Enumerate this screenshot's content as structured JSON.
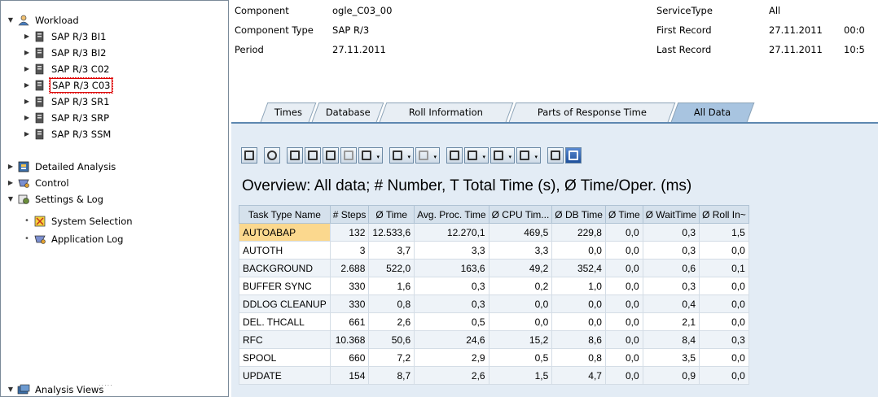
{
  "tree": {
    "workload": "Workload",
    "systems": [
      "SAP R/3 BI1",
      "SAP R/3 BI2",
      "SAP R/3 C02",
      "SAP R/3 C03",
      "SAP R/3 SR1",
      "SAP R/3 SRP",
      "SAP R/3 SSM"
    ],
    "detailed_analysis": "Detailed Analysis",
    "control": "Control",
    "settings_log": "Settings & Log",
    "system_selection": "System Selection",
    "application_log": "Application Log",
    "analysis_views": "Analysis Views",
    "grip": "....."
  },
  "header": {
    "component_label": "Component",
    "component_value": "ogle_C03_00",
    "component_type_label": "Component Type",
    "component_type_value": "SAP R/3",
    "period_label": "Period",
    "period_value": "27.11.2011",
    "service_type_label": "ServiceType",
    "service_type_value": "All",
    "first_record_label": "First Record",
    "first_record_date": "27.11.2011",
    "first_record_time": "00:0",
    "last_record_label": "Last Record",
    "last_record_date": "27.11.2011",
    "last_record_time": "10:5"
  },
  "tabs": [
    "Times",
    "Database",
    "Roll Information",
    "Parts of Response Time",
    "All Data"
  ],
  "active_tab": "All Data",
  "overview_title": "Overview: All data; # Number, T Total Time (s), Ø Time/Oper. (ms)",
  "table": {
    "columns": [
      "Task Type Name",
      "# Steps",
      "Ø Time",
      "Avg. Proc. Time",
      "Ø CPU Tim...",
      "Ø DB Time",
      "Ø Time",
      "Ø WaitTime",
      "Ø Roll In~"
    ],
    "rows": [
      [
        "AUTOABAP",
        "132",
        "12.533,6",
        "12.270,1",
        "469,5",
        "229,8",
        "0,0",
        "0,3",
        "1,5"
      ],
      [
        "AUTOTH",
        "3",
        "3,7",
        "3,3",
        "3,3",
        "0,0",
        "0,0",
        "0,3",
        "0,0"
      ],
      [
        "BACKGROUND",
        "2.688",
        "522,0",
        "163,6",
        "49,2",
        "352,4",
        "0,0",
        "0,6",
        "0,1"
      ],
      [
        "BUFFER SYNC",
        "330",
        "1,6",
        "0,3",
        "0,2",
        "1,0",
        "0,0",
        "0,3",
        "0,0"
      ],
      [
        "DDLOG CLEANUP",
        "330",
        "0,8",
        "0,3",
        "0,0",
        "0,0",
        "0,0",
        "0,4",
        "0,0"
      ],
      [
        "DEL. THCALL",
        "661",
        "2,6",
        "0,5",
        "0,0",
        "0,0",
        "0,0",
        "2,1",
        "0,0"
      ],
      [
        "RFC",
        "10.368",
        "50,6",
        "24,6",
        "15,2",
        "8,6",
        "0,0",
        "8,4",
        "0,3"
      ],
      [
        "SPOOL",
        "660",
        "7,2",
        "2,9",
        "0,5",
        "0,8",
        "0,0",
        "3,5",
        "0,0"
      ],
      [
        "UPDATE",
        "154",
        "8,7",
        "2,6",
        "1,5",
        "4,7",
        "0,0",
        "0,9",
        "0,0"
      ]
    ]
  },
  "colors": {
    "selected_cell": "#fbd88e",
    "pane_bg": "#e3ecf5",
    "active_tab": "#a8c4e0"
  }
}
